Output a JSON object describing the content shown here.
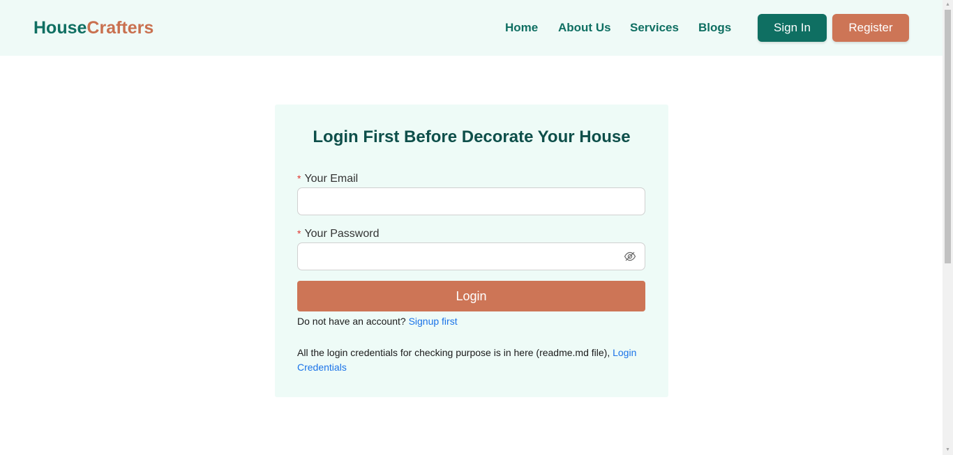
{
  "brand": {
    "part1": "House",
    "part2": "Crafters"
  },
  "nav": {
    "links": [
      "Home",
      "About Us",
      "Services",
      "Blogs"
    ],
    "signin_label": "Sign In",
    "register_label": "Register"
  },
  "login": {
    "title": "Login First Before Decorate Your House",
    "required_mark": "*",
    "email_label": "Your Email",
    "email_value": "",
    "password_label": "Your Password",
    "password_value": "",
    "button_label": "Login",
    "no_account_text": "Do not have an account?",
    "signup_link": "Signup first",
    "credentials_text": "All the login credentials for checking purpose is in here (readme.md file),",
    "credentials_link": "Login Credentials"
  },
  "icons": {
    "password_toggle": "eye-slash-icon"
  },
  "colors": {
    "primary": "#0f6f62",
    "accent": "#cd7556",
    "navbar_bg": "#effaf7",
    "card_bg": "#eefbf7",
    "link": "#1a73e8"
  }
}
